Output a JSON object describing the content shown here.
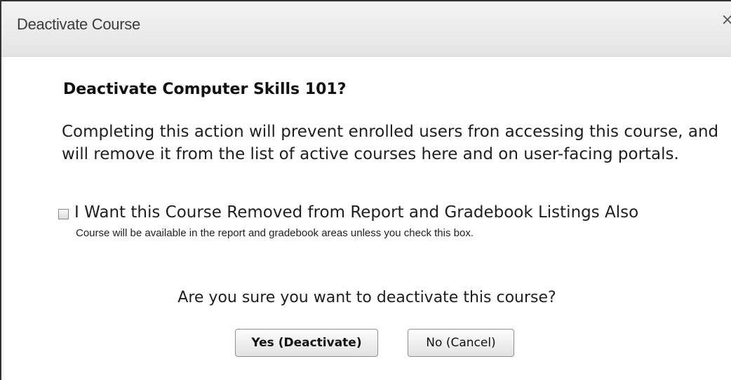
{
  "dialog": {
    "title": "Deactivate Course",
    "close_glyph": "×",
    "heading": "Deactivate Computer Skills 101?",
    "body": "Completing this action will prevent enrolled users fron accessing this course, and will remove it from the list of active courses here and on user-facing portals.",
    "checkbox": {
      "label": "I Want this Course Removed from Report and Gradebook Listings Also",
      "note": "Course will be available in the report and gradebook areas unless you check this box.",
      "checked": false
    },
    "question": "Are you sure you want to deactivate this course?",
    "buttons": {
      "yes_label": "Yes (Deactivate)",
      "no_label": "No (Cancel)"
    }
  }
}
